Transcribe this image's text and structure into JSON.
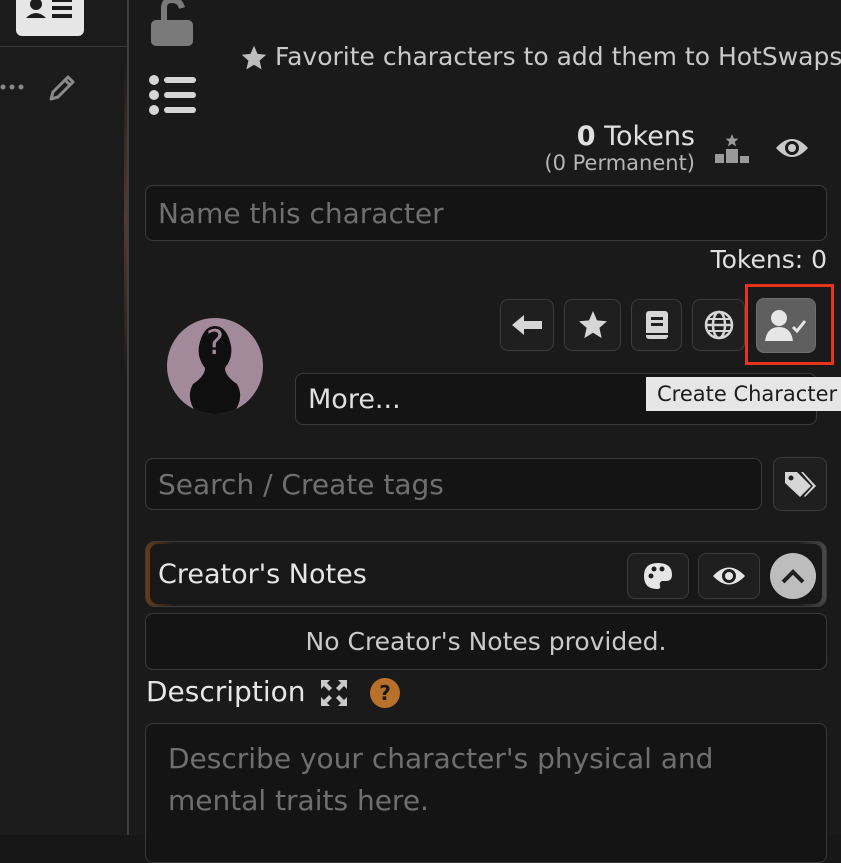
{
  "hotswaps": {
    "hint": "Favorite characters to add them to HotSwaps"
  },
  "tokens": {
    "count": "0",
    "label": "Tokens",
    "permanent": "(0 Permanent)"
  },
  "name_field": {
    "placeholder": "Name this character"
  },
  "token_counter": "Tokens: 0",
  "more_dropdown": {
    "label": "More..."
  },
  "tooltip": "Create Character",
  "tags_field": {
    "placeholder": "Search / Create tags"
  },
  "creator_notes": {
    "title": "Creator's Notes",
    "empty_text": "No Creator's Notes provided."
  },
  "description": {
    "title": "Description",
    "help_label": "?",
    "placeholder": "Describe your character's physical and mental traits here."
  },
  "icons": [
    "id-card-icon",
    "ellipsis-icon",
    "pencil-icon",
    "lock-open-icon",
    "list-icon",
    "star-icon",
    "podium-icon",
    "eye-icon",
    "arrow-left-icon",
    "book-icon",
    "globe-icon",
    "user-check-icon",
    "tags-icon",
    "palette-icon",
    "chevron-up-icon",
    "expand-icon",
    "question-icon"
  ],
  "colors": {
    "highlight": "#e8341c",
    "help_badge": "#b8702a",
    "accent_orange": "#c87a30"
  }
}
